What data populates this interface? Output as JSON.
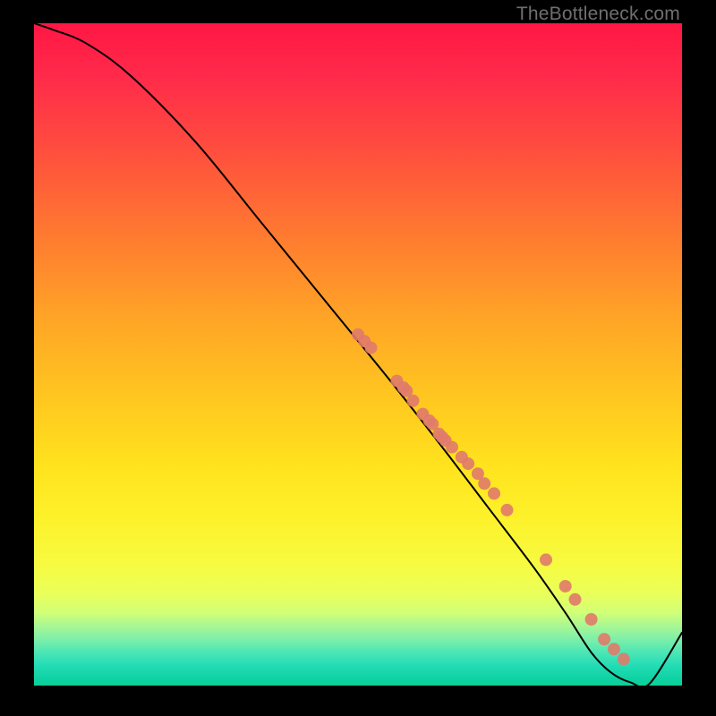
{
  "watermark": "TheBottleneck.com",
  "chart_data": {
    "type": "line",
    "title": "",
    "xlabel": "",
    "ylabel": "",
    "x_range": [
      0,
      100
    ],
    "y_range": [
      0,
      100
    ],
    "series": [
      {
        "name": "bottleneck-curve",
        "x": [
          0,
          3,
          8,
          15,
          25,
          35,
          45,
          55,
          63,
          70,
          77,
          82,
          86,
          89,
          92,
          95,
          100
        ],
        "y": [
          100,
          99,
          97,
          92,
          82,
          70,
          58,
          46,
          36,
          27,
          18,
          11,
          5,
          2,
          0.5,
          0.3,
          8
        ]
      }
    ],
    "markers": {
      "name": "sample-points",
      "color": "#e07a6a",
      "x": [
        50,
        51,
        52,
        56,
        57,
        57.5,
        58.5,
        60,
        61,
        61.5,
        62.5,
        63,
        63.5,
        64.5,
        66,
        67,
        68.5,
        69.5,
        71,
        73,
        79,
        82,
        83.5,
        86,
        88,
        89.5,
        91
      ],
      "y": [
        53,
        52,
        51,
        46,
        45,
        44.5,
        43,
        41,
        40,
        39.5,
        38,
        37.5,
        37,
        36,
        34.5,
        33.5,
        32,
        30.5,
        29,
        26.5,
        19,
        15,
        13,
        10,
        7,
        5.5,
        4
      ]
    },
    "background_gradient": {
      "top": "#ff1744",
      "upper_mid": "#ffc81f",
      "lower_mid": "#fdf22b",
      "bottom": "#0ccf97"
    }
  }
}
